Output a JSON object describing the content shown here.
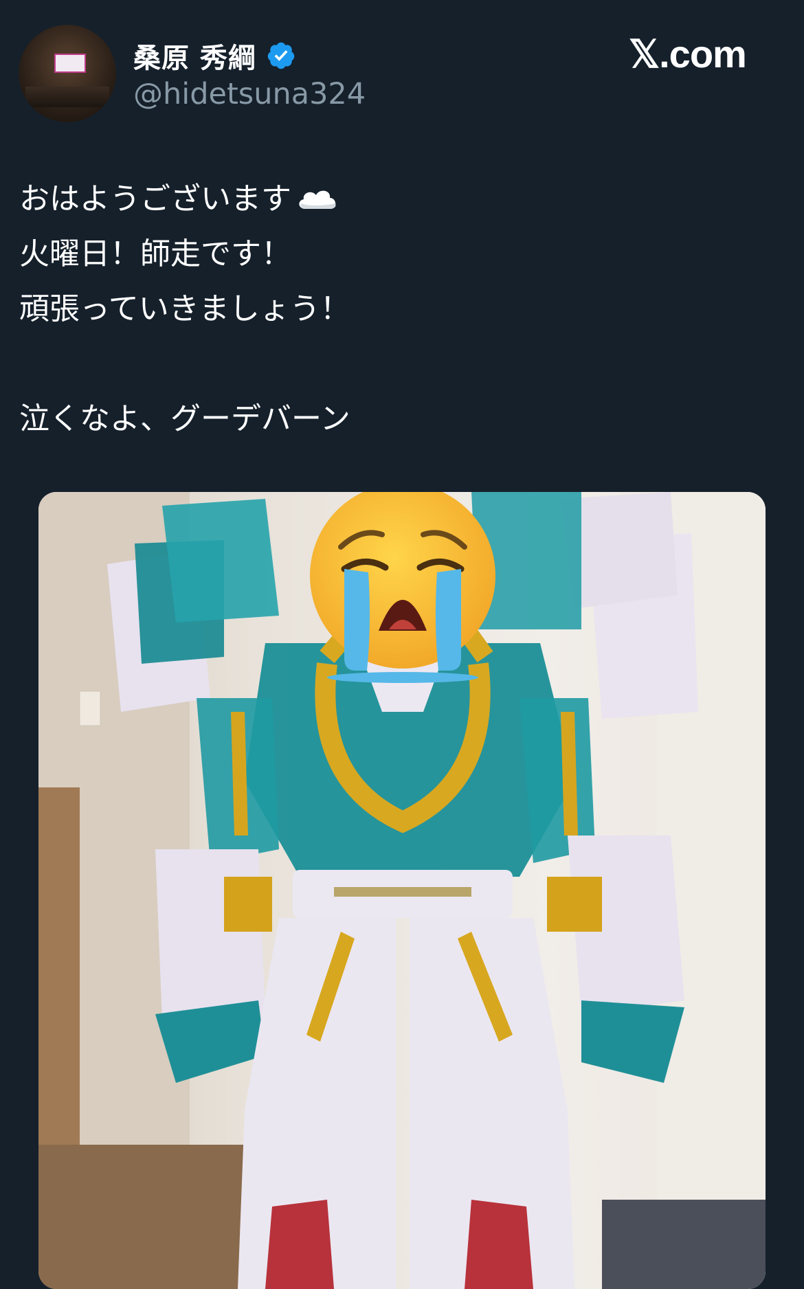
{
  "author": {
    "display_name": "桑原 秀綱",
    "handle": "@hidetsuna324",
    "verified": true,
    "avatar_icon": "studio-avatar"
  },
  "site": {
    "label": "𝕏.com"
  },
  "tweet": {
    "lines": [
      "おはようございます",
      "火曜日！師走です！",
      "頑張っていきましょう！",
      "泣くなよ、グーデバーン"
    ],
    "first_line_emoji": "cloud-icon"
  },
  "media": {
    "description_icon": "robot-toy-photo",
    "overlay_emoji": "crying-face-icon"
  },
  "colors": {
    "background": "#15202b",
    "verified": "#1d9bf0",
    "handle": "#8899a6"
  }
}
